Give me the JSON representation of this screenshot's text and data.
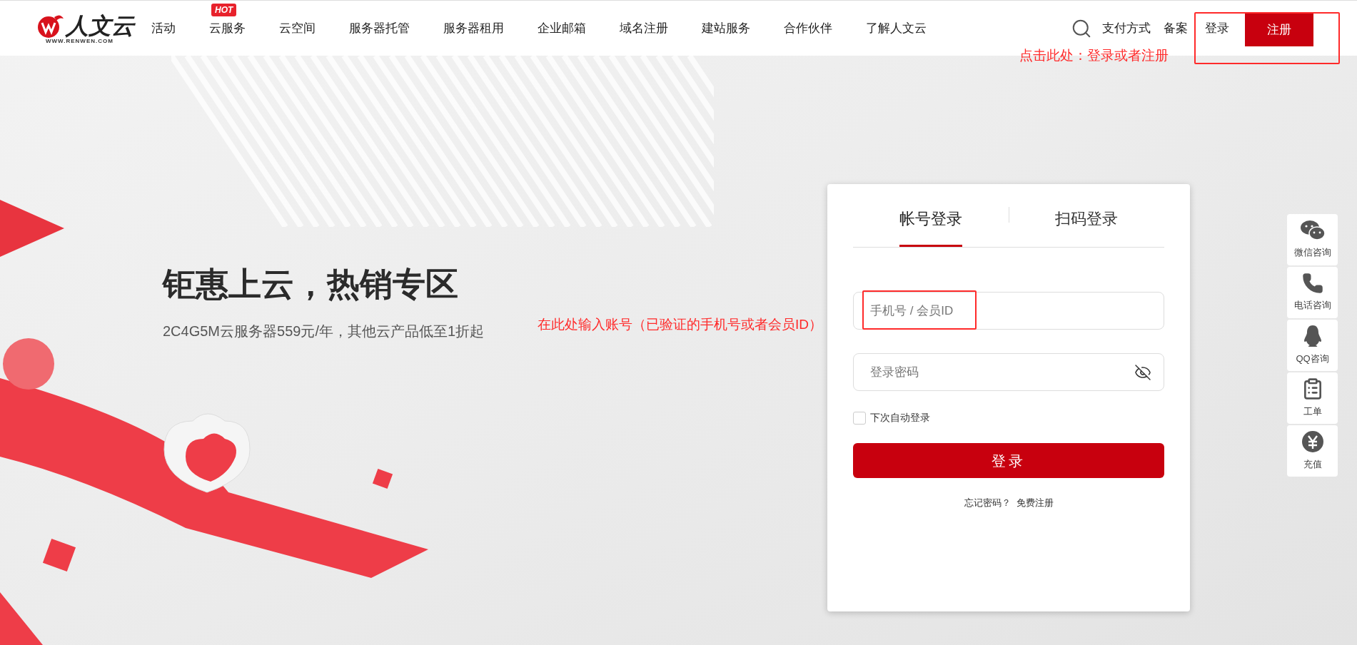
{
  "header": {
    "logo": {
      "name": "人文云",
      "url": "WWW.RENWEN.COM"
    },
    "nav": [
      {
        "label": "活动"
      },
      {
        "label": "云服务",
        "badge": "HOT"
      },
      {
        "label": "云空间"
      },
      {
        "label": "服务器托管"
      },
      {
        "label": "服务器租用"
      },
      {
        "label": "企业邮箱"
      },
      {
        "label": "域名注册"
      },
      {
        "label": "建站服务"
      },
      {
        "label": "合作伙伴"
      },
      {
        "label": "了解人文云"
      }
    ],
    "links": [
      "支付方式",
      "备案"
    ],
    "login": "登录",
    "register": "注册"
  },
  "hero": {
    "title": "钜惠上云，热销专区",
    "subtitle": "2C4G5M云服务器559元/年，其他云产品低至1折起"
  },
  "login_card": {
    "tabs": [
      {
        "label": "帐号登录",
        "selected": true
      },
      {
        "label": "扫码登录",
        "selected": false
      }
    ],
    "account": {
      "placeholder": "手机号 / 会员ID"
    },
    "password": {
      "placeholder": "登录密码"
    },
    "remember": {
      "label": "下次自动登录",
      "checked": false
    },
    "submit": "登录",
    "forgot": "忘记密码？",
    "register": "免费注册"
  },
  "side_tools": [
    {
      "label": "微信咨询",
      "kind": "wechat"
    },
    {
      "label": "电话咨询",
      "kind": "phone"
    },
    {
      "label": "QQ咨询",
      "kind": "qq"
    },
    {
      "label": "工单",
      "kind": "ticket"
    },
    {
      "label": "充值",
      "kind": "recharge"
    }
  ],
  "annotations": [
    {
      "text": "点击此处：登录或者注册",
      "kind": "header"
    },
    {
      "text": "在此处输入账号（已验证的手机号或者会员ID）",
      "kind": "account"
    }
  ]
}
